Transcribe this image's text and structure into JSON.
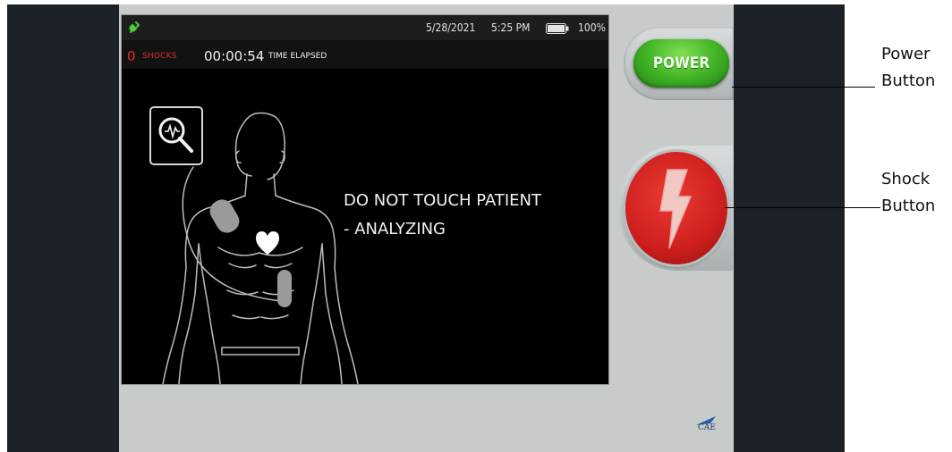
{
  "status_bar": {
    "date": "5/28/2021",
    "time": "5:25 PM",
    "battery_percent": "100%",
    "power_icon": "plug-icon",
    "battery_icon": "battery-icon"
  },
  "info_bar": {
    "shock_count": "0",
    "shocks_label": "SHOCKS",
    "elapsed_time": "00:00:54",
    "elapsed_label": "TIME ELAPSED"
  },
  "message": {
    "line1": "DO NOT TOUCH PATIENT",
    "line2": "- ANALYZING"
  },
  "buttons": {
    "power_label": "POWER",
    "shock_icon": "lightning-bolt-icon"
  },
  "callouts": {
    "power_line1": "Power",
    "power_line2": "Button",
    "shock_line1": "Shock",
    "shock_line2": "Button"
  },
  "logo": {
    "text": "CAE"
  },
  "colors": {
    "shock_red": "#e03030",
    "power_green": "#3fb023",
    "shock_button_red": "#cc1f1d",
    "panel_dark": "#1b2127",
    "device_gray": "#c7cbca"
  }
}
